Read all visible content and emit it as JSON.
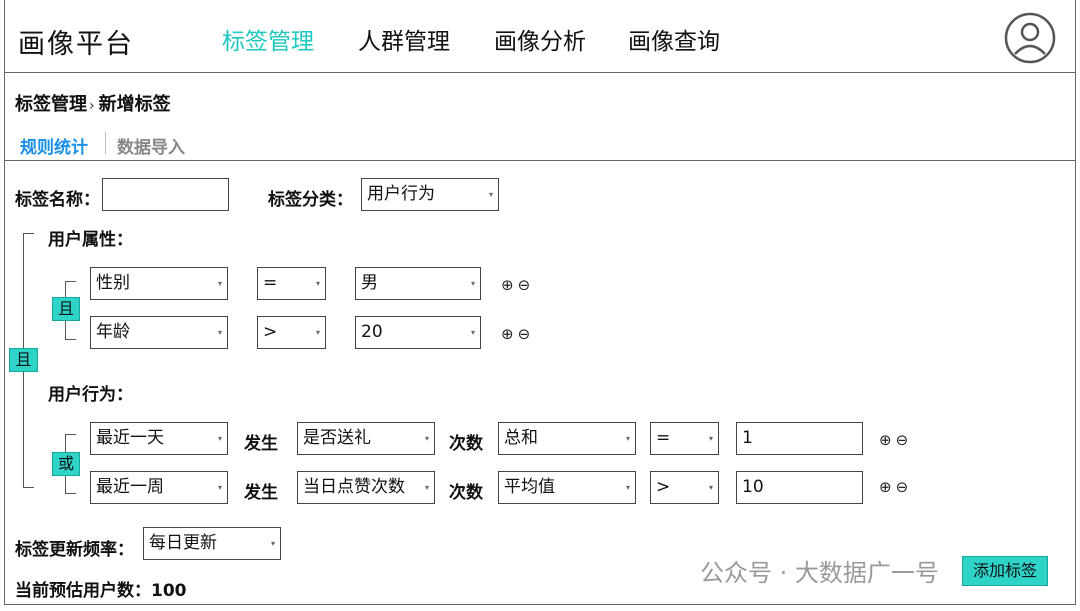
{
  "header": {
    "logo": "画像平台",
    "nav": [
      {
        "label": "标签管理",
        "active": true
      },
      {
        "label": "人群管理",
        "active": false
      },
      {
        "label": "画像分析",
        "active": false
      },
      {
        "label": "画像查询",
        "active": false
      }
    ]
  },
  "breadcrumb": {
    "parent": "标签管理",
    "sep": "›",
    "current": "新增标签"
  },
  "tabs": [
    {
      "label": "规则统计",
      "active": true
    },
    {
      "label": "数据导入",
      "active": false
    }
  ],
  "form": {
    "name_label": "标签名称：",
    "name_value": "",
    "category_label": "标签分类：",
    "category_value": "用户行为"
  },
  "root_logic": "且",
  "user_attr": {
    "title": "用户属性：",
    "logic": "且",
    "rows": [
      {
        "field": "性别",
        "op": "=",
        "value": "男"
      },
      {
        "field": "年龄",
        "op": ">",
        "value": "20"
      }
    ]
  },
  "user_behavior": {
    "title": "用户行为：",
    "logic": "或",
    "happen_label": "发生",
    "count_label": "次数",
    "rows": [
      {
        "period": "最近一天",
        "action": "是否送礼",
        "agg": "总和",
        "op": "=",
        "value": "1"
      },
      {
        "period": "最近一周",
        "action": "当日点赞次数",
        "agg": "平均值",
        "op": ">",
        "value": "10"
      }
    ]
  },
  "update": {
    "label": "标签更新频率：",
    "value": "每日更新"
  },
  "estimate": {
    "label": "当前预估用户数：",
    "value": "100"
  },
  "add_button": "添加标签",
  "watermark": "公众号 · 大数据广一号",
  "colors": {
    "accent": "#2fd4c8",
    "nav_active": "#1fc8c0",
    "tab_active": "#1a8fe6"
  }
}
